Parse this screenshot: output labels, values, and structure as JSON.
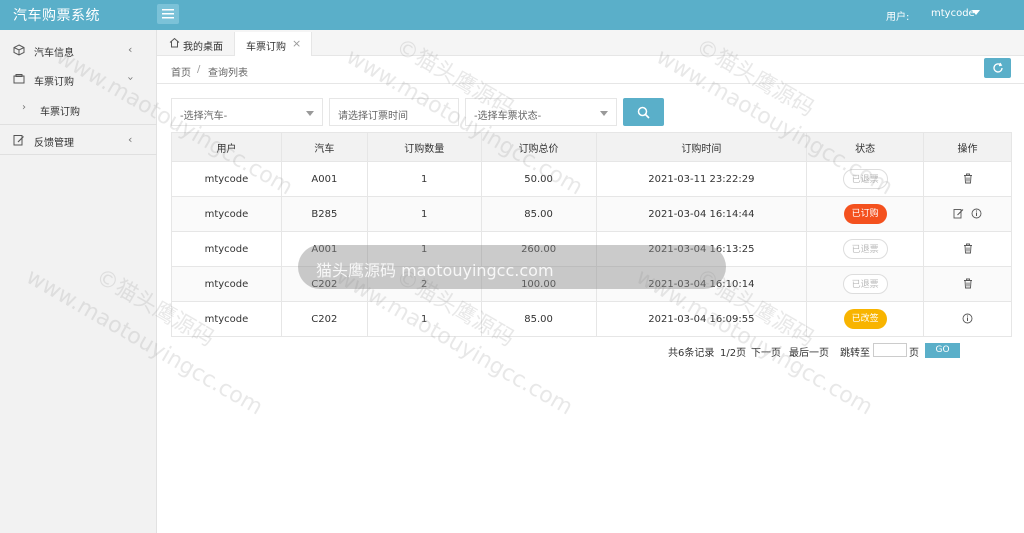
{
  "header": {
    "title": "汽车购票系统",
    "user_label": "用户:",
    "user_name": "mtycode"
  },
  "sidebar": {
    "items": [
      {
        "label": "汽车信息",
        "icon": "cube-icon"
      },
      {
        "label": "车票订购",
        "icon": "ticket-icon"
      },
      {
        "label": "车票订购",
        "icon": "none"
      },
      {
        "label": "反馈管理",
        "icon": "edit-icon"
      }
    ]
  },
  "tabs": {
    "home": "我的桌面",
    "active": "车票订购"
  },
  "breadcrumb": {
    "home": "首页",
    "sep": "/",
    "current": "查询列表"
  },
  "filters": {
    "car_placeholder": "-选择汽车-",
    "time_placeholder": "请选择订票时间",
    "status_placeholder": "-选择车票状态-"
  },
  "table": {
    "headers": [
      "用户",
      "汽车",
      "订购数量",
      "订购总价",
      "订购时间",
      "状态",
      "操作"
    ],
    "rows": [
      {
        "user": "mtycode",
        "car": "A001",
        "qty": "1",
        "price": "50.00",
        "time": "2021-03-11 23:22:29",
        "status": "已退票"
      },
      {
        "user": "mtycode",
        "car": "B285",
        "qty": "1",
        "price": "85.00",
        "time": "2021-03-04 16:14:44",
        "status": "已订购"
      },
      {
        "user": "mtycode",
        "car": "A001",
        "qty": "1",
        "price": "260.00",
        "time": "2021-03-04 16:13:25",
        "status": "已退票"
      },
      {
        "user": "mtycode",
        "car": "C202",
        "qty": "2",
        "price": "100.00",
        "time": "2021-03-04 16:10:14",
        "status": "已退票"
      },
      {
        "user": "mtycode",
        "car": "C202",
        "qty": "1",
        "price": "85.00",
        "time": "2021-03-04 16:09:55",
        "status": "已改签"
      }
    ]
  },
  "pager": {
    "total": "共6条记录",
    "page": "1/2页",
    "next": "下一页",
    "last": "最后一页",
    "jump": "跳转至",
    "page_unit": "页",
    "go": "GO"
  },
  "watermark": {
    "bar_text": "猫头鹰源码 maotouyingcc.com",
    "repeat_text": "www.maotouyingcc.com",
    "repeat_text_cn": "©猫头鹰源码"
  },
  "colors": {
    "primary": "#5aafc9",
    "ordered": "#f4511e",
    "changed": "#f8b400"
  }
}
